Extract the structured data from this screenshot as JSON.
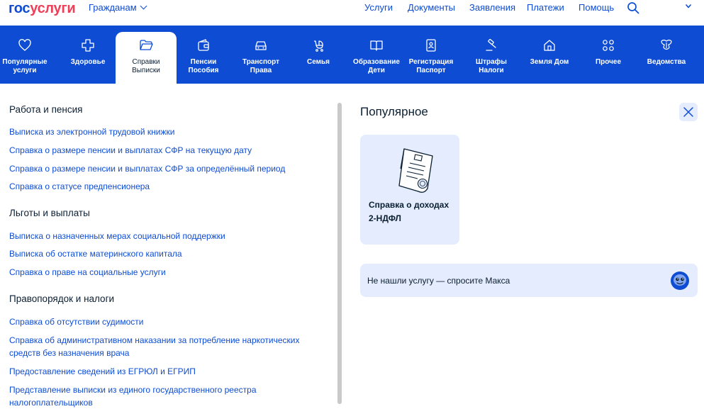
{
  "header": {
    "logo_part1": "гос",
    "logo_part2": "услуги",
    "audience": "Гражданам",
    "nav": [
      "Услуги",
      "Документы",
      "Заявления",
      "Платежи",
      "Помощь"
    ]
  },
  "categories": [
    {
      "line1": "Популярные",
      "line2": "услуги",
      "icon": "heart-icon"
    },
    {
      "line1": "Здоровье",
      "line2": "",
      "icon": "medical-cross-icon"
    },
    {
      "line1": "Справки",
      "line2": "Выписки",
      "icon": "folder-icon",
      "active": true
    },
    {
      "line1": "Пенсии",
      "line2": "Пособия",
      "icon": "wallet-icon"
    },
    {
      "line1": "Транспорт",
      "line2": "Права",
      "icon": "car-icon"
    },
    {
      "line1": "Семья",
      "line2": "",
      "icon": "stroller-icon"
    },
    {
      "line1": "Образование",
      "line2": "Дети",
      "icon": "book-icon"
    },
    {
      "line1": "Регистрация",
      "line2": "Паспорт",
      "icon": "id-card-icon"
    },
    {
      "line1": "Штрафы",
      "line2": "Налоги",
      "icon": "gavel-icon"
    },
    {
      "line1": "Земля Дом",
      "line2": "",
      "icon": "house-icon"
    },
    {
      "line1": "Прочее",
      "line2": "",
      "icon": "grid-icon"
    },
    {
      "line1": "Ведомства",
      "line2": "",
      "icon": "emblem-icon"
    }
  ],
  "sections": [
    {
      "title": "Работа и пенсия",
      "links": [
        "Выписка из электронной трудовой книжки",
        "Справка о размере пенсии и выплатах СФР на текущую дату",
        "Справка о размере пенсии и выплатах СФР за определённый период",
        "Справка о статусе предпенсионера"
      ]
    },
    {
      "title": "Льготы и выплаты",
      "links": [
        "Выписка о назначенных мерах социальной поддержки",
        "Выписка об остатке материнского капитала",
        "Справка о праве на социальные услуги"
      ]
    },
    {
      "title": "Правопорядок и налоги",
      "links": [
        "Справка об отсутствии судимости",
        "Справка об административном наказании за потребление наркотических средств без назначения врача",
        "Предоставление сведений из ЕГРЮЛ и ЕГРИП",
        "Представление выписки из единого государственного реестра налогоплательщиков"
      ]
    }
  ],
  "popular": {
    "title": "Популярное",
    "card_title": "Справка о доходах 2-НДФЛ",
    "ask_text": "Не нашли услугу — спросите Макса"
  },
  "colors": {
    "brand_blue": "#0d4cd3",
    "brand_red": "#ee3f58",
    "light_blue": "#e4ecfd",
    "text_dark": "#0b1f33"
  }
}
